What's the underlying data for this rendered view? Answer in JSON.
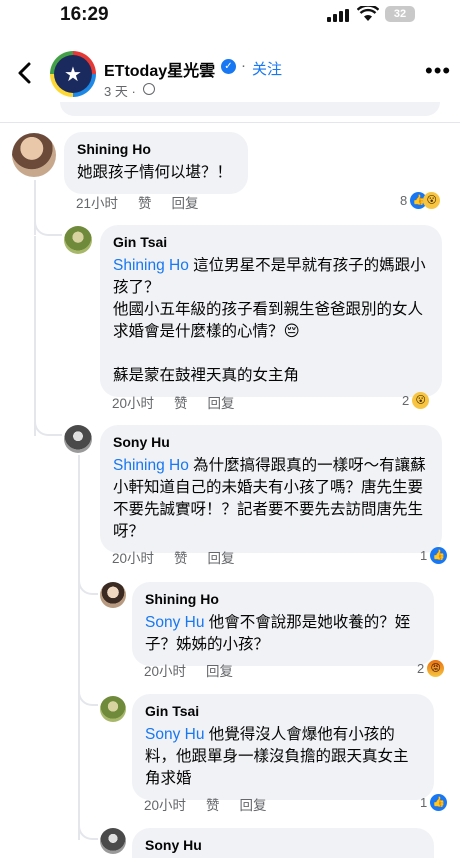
{
  "status_bar": {
    "time": "16:29",
    "battery": "32"
  },
  "header": {
    "page_name": "ETtoday星光雲",
    "follow_label": "关注",
    "post_time": "3 天 ·"
  },
  "comments": [
    {
      "author": "Shining Ho",
      "mention": "",
      "text": "她跟孩子情何以堪？！",
      "time": "21小时",
      "like": "赞",
      "reply": "回复",
      "reaction_count": "8"
    },
    {
      "author": "Gin Tsai",
      "mention": "Shining Ho",
      "text": " 這位男星不是早就有孩子的媽跟小孩了？\n他國小五年級的孩子看到親生爸爸跟別的女人求婚會是什麼樣的心情？😔\n\n蘇是蒙在鼓裡天真的女主角",
      "time": "20小时",
      "like": "赞",
      "reply": "回复",
      "reaction_count": "2"
    },
    {
      "author": "Sony Hu",
      "mention": "Shining Ho",
      "text": " 為什麼搞得跟真的一樣呀～有讓蘇小軒知道自己的未婚夫有小孩了嗎？唐先生要不要先誠實呀！？記者要不要先去訪問唐先生呀？",
      "time": "20小时",
      "like": "赞",
      "reply": "回复",
      "reaction_count": "1"
    },
    {
      "author": "Shining Ho",
      "mention": "Sony Hu",
      "text": " 他會不會說那是她收養的？姪子？姊姊的小孩？",
      "time": "20小时",
      "like": "",
      "reply": "回复",
      "reaction_count": "2"
    },
    {
      "author": "Gin Tsai",
      "mention": "Sony Hu",
      "text": " 他覺得沒人會爆他有小孩的料，他跟單身一樣沒負擔的跟天真女主角求婚",
      "time": "20小时",
      "like": "赞",
      "reply": "回复",
      "reaction_count": "1"
    },
    {
      "author": "Sony Hu"
    }
  ]
}
